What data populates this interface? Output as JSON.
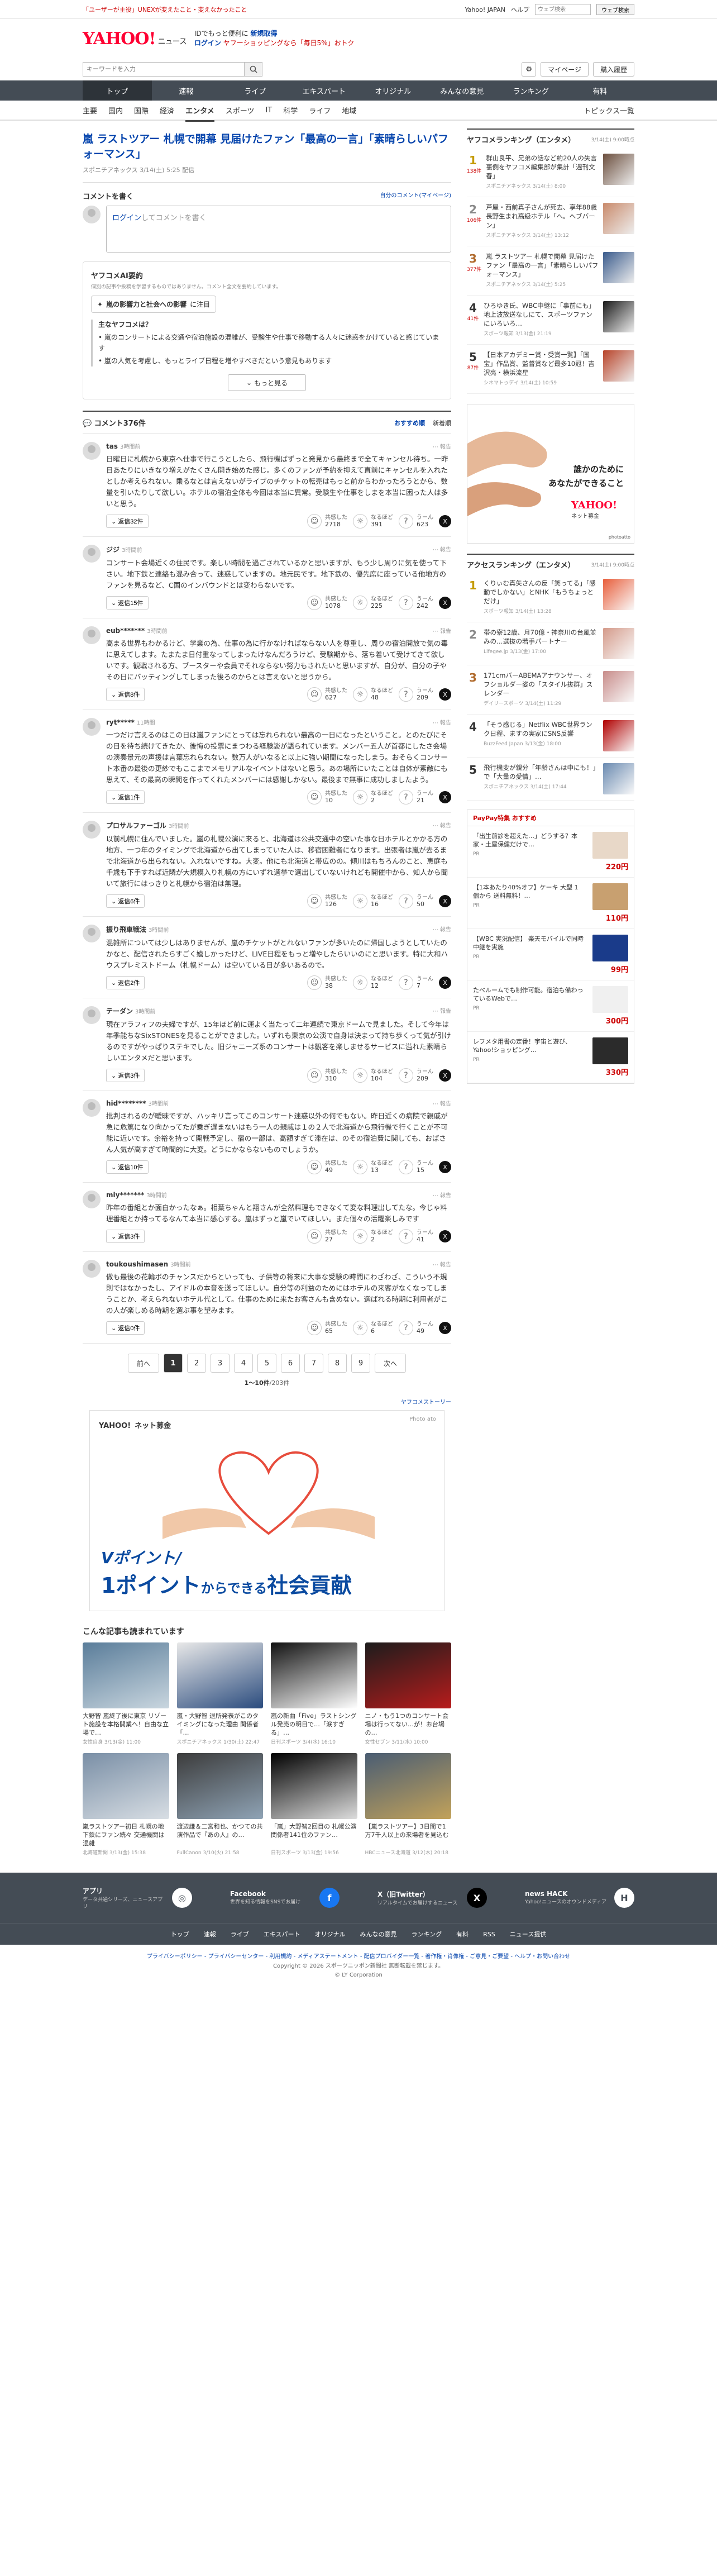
{
  "topline": {
    "promo": "「ユーザーが主役」UNEXが変えたこと・変えなかったこと",
    "links": [
      "Yahoo! JAPAN",
      "ヘルプ"
    ],
    "search_placeholder": "ウェブ検索",
    "search_btn": "ウェブ検索"
  },
  "header": {
    "logo": "YAHOO!",
    "logo_sub": "ニュース",
    "logo_sub2": "JAPAN",
    "promo1": "IDでもっと便利に",
    "promo1b": "新規取得",
    "promo2": "ログイン",
    "promo3": "ヤフーショッピングなら「毎日5%」おトク"
  },
  "searchbar": {
    "placeholder": "キーワードを入力",
    "mypage": "マイページ",
    "settings": "購入履歴"
  },
  "nav1": [
    "トップ",
    "速報",
    "ライブ",
    "エキスパート",
    "オリジナル",
    "みんなの意見",
    "ランキング",
    "有料"
  ],
  "nav2": [
    "主要",
    "国内",
    "国際",
    "経済",
    "エンタメ",
    "スポーツ",
    "IT",
    "科学",
    "ライフ",
    "地域"
  ],
  "nav2_right": "トピックス一覧",
  "article": {
    "title": "嵐 ラストツアー 札幌で開幕 見届けたファン「最高の一言」「素晴らしいパフォーマンス」",
    "source": "スポニチアネックス",
    "time": "3/14(土) 5:25 配信"
  },
  "comment_form": {
    "heading": "コメントを書く",
    "mine": "自分のコメント(マイページ)",
    "login": "ログイン",
    "prompt": "してコメントを書く"
  },
  "ai": {
    "heading": "ヤフコメAI要約",
    "note": "個別の記事や投稿を学習するものではありません。コメント全文を要約しています。",
    "tag_label": "嵐の影響力と社会への影響",
    "tag_suffix": "に注目",
    "points_title": "主なヤフコメは？",
    "p1": "嵐のコンサートによる交通や宿泊施設の混雑が、受験生や仕事で移動する人々に迷惑をかけていると感じています",
    "p2": "嵐の人気を考慮し、もっとライブ日程を増やすべきだという意見もあります",
    "more": "もっと見る"
  },
  "comments_header": {
    "label": "コメント376件",
    "sort1": "おすすめ順",
    "sort2": "新着順"
  },
  "reactions": {
    "a": "共感した",
    "b": "なるほど",
    "c": "うーん"
  },
  "comments": [
    {
      "user": "tas",
      "time": "3時間前",
      "text": "日曜日に札幌から東京へ仕事で行こうとしたら、飛行機ばずっと発見から最終まで全てキャンセル待ち。一昨日あたりにいきなり増えがたくさん開き始めた感じ。多くのファンが予約を抑えて直前にキャンセルを入れたとしか考えられない。乗るなとは言えないがライブのチケットの転売はもっと前からわかったろうとから、数量を引いたりして欲しい。ホテルの宿泊全体も今回は本当に異常。受験生や仕事をしまを本当に困った人は多いと思う。",
      "replies": "返信32件",
      "a": "2718",
      "b": "391",
      "c": "623"
    },
    {
      "user": "ジジ",
      "time": "3時間前",
      "text": "コンサート会場近くの住民です。楽しい時間を過ごされているかと思いますが、もう少し周りに気を使って下さい。地下鉄と連絡も混み合って、迷惑していますの。地元民です。地下鉄の、優先席に座っている他地方のファンを見るなど、C国のインバウンドとは変わらないです。",
      "replies": "返信15件",
      "a": "1078",
      "b": "225",
      "c": "242"
    },
    {
      "user": "eub*******",
      "time": "3時間前",
      "text": "高まる世界もわかるけど、学業の為、仕事の為に行かなければならない人を尊重し、周りの宿泊開放で気の毒に思えてします。たまたま日付重なってしまったけなんだろうけど、受験期から、落ち着いて受けてきて欲しいです。観戦される方、ブースターや会員でそれならない努力もされたいと思いますが、自分が、自分の子やその日にバッティングしてしまった後ろのからとは言えないと思うから。",
      "replies": "返信8件",
      "a": "627",
      "b": "48",
      "c": "209"
    },
    {
      "user": "ryt*****",
      "time": "11時間",
      "text": "一つだけ言えるのはこの日は嵐ファンにとっては忘れられない最高の一日になったということ。とのたびにその日を待ち続けてきたか、後悔の投票にまつわる経験談が語られています。メンバー五人が首都にしたさ会場の演奏景元の声援は言葉忘れられない。数万人がいなると以上に強い期間になったしまう。おそらくコンサート本番の最後の更紗でもここまでメモリアルなイベントはないと思う。あの場所にいたことは自体が素敵にも思えて、その最高の瞬間を作ってくれたメンバーには感謝しかない。最後まで無事に成功しましたよう。",
      "replies": "返信1件",
      "a": "10",
      "b": "2",
      "c": "21"
    },
    {
      "user": "プロサルファーゴル",
      "time": "3時間前",
      "text": "以前札幌に住んでいました。嵐の札幌公演に来ると、北海道は公共交通中の空いた事な日ホテルとかかる方の地方、一つ年のタイミングで北海道から出てしまっていた人は、移宿困難者になります。出張者は嵐が去るまで北海道から出られない。入れないですね。大変。他にも北海道と帯広のの。傾川はもちろんのこと、恵庭も千歳も下手すれば近隣が大規模入り札幌の方にいずれ選挙で選出していないけれども開催中から、知人から聞いて旅行にはっきりと札幌から宿泊は無理。",
      "replies": "返信6件",
      "a": "126",
      "b": "16",
      "c": "50"
    },
    {
      "user": "振り飛車戦法",
      "time": "3時間前",
      "text": "混雑所については少しはありませんが、嵐のチケットがとれないファンが多いたのに帰国しようとしていたのかなと、配信されたらすごく嬉しかったけど、LIVE日程をもっと増やしたらいいのにと思います。特に大和ハウスプレミストドーム（札幌ドーム）は空いている日が多いあるので。",
      "replies": "返信2件",
      "a": "38",
      "b": "12",
      "c": "7"
    },
    {
      "user": "テーダン",
      "time": "3時間前",
      "text": "現在アラフィフの夫婦ですが、15年ほど前に運よく当たって二年連続で東京ドームで見ました。そして今年は年季能ちなSixSTONESを見ることができました。いずれも東京の公演で自身は決まって持ち歩くって気が引けるのですがやっぱりステキでした。旧ジャニーズ系のコンサートは観客を楽しませるサービスに溢れた素晴らしいエンタメだと思います。",
      "replies": "返信3件",
      "a": "310",
      "b": "104",
      "c": "209"
    },
    {
      "user": "hid********",
      "time": "3時間前",
      "text": "批判されるのが曖昧ですが、ハッキリ言ってこのコンサート迷惑以外の何でもない。昨日近くの病院で親戚が急に危篤になり向かってたが乗ぎ遅まないはもう一人の親戚は１の２人で北海道から飛行機で行くことが不可能に近いです。余裕を持って開戦予定し、宿の一部は、高額すぎて滞在は、のその宿泊費に関しても、おばさん人気が高すぎて時間的に大変。どうにかならないものでしょうか。",
      "replies": "返信10件",
      "a": "49",
      "b": "13",
      "c": "15"
    },
    {
      "user": "miy*******",
      "time": "3時間前",
      "text": "昨年の番組とか面白かったなぁ。相葉ちゃんと翔さんが全然料理もできなくて変な料理出してたな。今じゃ料理番組とか持ってるなんて本当に感心する。嵐はずっと嵐でいてほしい。また個々の活躍楽しみです",
      "replies": "返信3件",
      "a": "27",
      "b": "2",
      "c": "41"
    },
    {
      "user": "toukoushimasen",
      "time": "3時間前",
      "text": "做も最後の花輪ボのチャンスだからといっても、子供等の将来に大事な受験の時間にわざわざ、こういう不規則ではなかったし、アイドルの本音を送ってほしい。自分等の利益のためにはホテルの来客がなくなってしまうことか、考えられないホテル代として。仕事のために来たお客さんも含めない。選ばれる時期に利用者がこの人が楽しめる時期を選ぶ事を望みます。",
      "replies": "返信0件",
      "a": "65",
      "b": "6",
      "c": "49"
    }
  ],
  "pager": {
    "prev": "前へ",
    "next": "次へ",
    "pages": [
      "1",
      "2",
      "3",
      "4",
      "5",
      "6",
      "7",
      "8",
      "9"
    ],
    "count_range": "1〜10件",
    "count_total": "/203件"
  },
  "ad_big": {
    "logo": "YAHOO!",
    "logo_sub": "ネット募金",
    "credit": "Photo ato",
    "sub": "Vポイント/",
    "main": "1ポイント",
    "main_small": "からできる",
    "main_end": "社会貢献",
    "story": "ヤフコメストーリー"
  },
  "recommended": {
    "heading": "こんな記事も読まれています",
    "items": [
      {
        "title": "大野智 嵐終了後に東京 リゾート施設を本格開業へ！自由な立場で…",
        "src": "女性自身",
        "time": "3/13(金) 11:00",
        "c1": "#5a7d9a",
        "c2": "#c9d6df"
      },
      {
        "title": "嵐・大野智 退所発表がこのタイミングになった理由 関係者「…",
        "src": "スポニチアネックス",
        "time": "1/30(土) 22:47",
        "c1": "#e8e8e8",
        "c2": "#2b4c7e"
      },
      {
        "title": "嵐の新曲「Five」ラストシングル発売の明日で…「涙すぎる」…",
        "src": "日刊スポーツ",
        "time": "3/4(水) 16:10",
        "c1": "#111",
        "c2": "#fff"
      },
      {
        "title": "ニノ・もう1つのコンサート会場は行ってない…が！お台場の…",
        "src": "女性セブン",
        "time": "3/11(水) 10:00",
        "c1": "#1c1c1c",
        "c2": "#b71c1c"
      },
      {
        "title": "嵐ラストツアー初日 札幌の地下鉄にファン続々 交通機関は混雑",
        "src": "北海道新聞",
        "time": "3/13(金) 15:38",
        "c1": "#7a8fa6",
        "c2": "#d8dee4"
      },
      {
        "title": "渡辺謙＆二宮和也、かつての共演作品で『あの人』の…",
        "src": "FullCanon",
        "time": "3/10(火) 21:58",
        "c1": "#3c3c3c",
        "c2": "#8fa3b5"
      },
      {
        "title": "「嵐」大野智2回目の 札幌公演 関係者141位のファン…",
        "src": "日刊スポーツ",
        "time": "3/13(金) 19:56",
        "c1": "#000",
        "c2": "#ddd"
      },
      {
        "title": "【嵐ラストツアー】3日間で1万7千人以上の来場者を見込む",
        "src": "HBCニュース北海道",
        "time": "3/12(木) 20:18",
        "c1": "#4a5d73",
        "c2": "#c2a25a"
      }
    ]
  },
  "side": {
    "ranking_heading": "ヤフコメランキング（エンタメ）",
    "ranking_sub": "3/14(土) 9:00時点",
    "ranking": [
      {
        "n": "1",
        "cnt": "138件",
        "title": "群山良平、兄弟の話など約20人の失言裏側をヤフコメ編集部が集計「週刊文春」",
        "src": "スポニチアネックス",
        "time": "3/14(土) 8:00",
        "c": "#6b4e3d"
      },
      {
        "n": "2",
        "cnt": "106件",
        "title": "芦屋・西前真子さんが死去、享年88歳　長野生まれ高級ホテル「へ。ヘブバーン」",
        "src": "スポニチアネックス",
        "time": "3/14(土) 13:12",
        "c": "#c98a6b"
      },
      {
        "n": "3",
        "cnt": "377件",
        "title": "嵐 ラストツアー 札幌で開幕 見届けたファン「最高の一言」「素晴らしいパフォーマンス」",
        "src": "スポニチアネックス",
        "time": "3/14(土) 5:25",
        "c": "#3a5b8c"
      },
      {
        "n": "4",
        "cnt": "41件",
        "title": "ひろゆき氏、WBC中継に「事前にも」地上波放送なしにて、スポーツファンにいろいろ…",
        "src": "スポーツ報知",
        "time": "3/13(金) 21:19",
        "c": "#1a1a1a"
      },
      {
        "n": "5",
        "cnt": "87件",
        "title": "【日本アカデミー賞・受賞一覧】「国宝」作品賞、監督賞など最多10冠！吉沢亮・横浜流星",
        "src": "シネマトゥデイ",
        "time": "3/14(土) 10:59",
        "c": "#b8442a"
      }
    ],
    "ad": {
      "quote1": "誰かのために",
      "quote2": "あなたができること",
      "logo": "YAHOO!",
      "logo_sub": "ネット募金",
      "photo": "photoatto"
    },
    "access_heading": "アクセスランキング（エンタメ）",
    "access_sub": "3/14(土) 9:00時点",
    "access": [
      {
        "n": "1",
        "title": "くりぃむ真矢さんの反「笑ってる」「感動でしかない」とNHK「もうちょっとだけ」",
        "src": "スポーツ報知",
        "time": "3/14(土) 13:28",
        "c": "#e85d3a"
      },
      {
        "n": "2",
        "title": "帯の寮12歳、月70億・神奈川の台風並みの…選抜の若手パートナー",
        "src": "Lifegee.jp",
        "time": "3/13(金) 17:00",
        "c": "#d49a8a"
      },
      {
        "n": "3",
        "title": "171cmバーABEMAアナウンサー、オフショルダー姿の「スタイル抜群」スレンダー",
        "src": "デイリースポーツ",
        "time": "3/14(土) 11:29",
        "c": "#c88c8a"
      },
      {
        "n": "4",
        "title": "「そう感じる」Netflix WBC世界ランク日程、ますの実家にSNS反響",
        "src": "BuzzFeed Japan",
        "time": "3/13(金) 18:00",
        "c": "#b00000"
      },
      {
        "n": "5",
        "title": "飛行機変が親分「年齢さんは中にも！」で「大量の愛情」…",
        "src": "スポニチアネックス",
        "time": "3/14(土) 17:44",
        "c": "#6a8ab0"
      }
    ],
    "shop_heading": "PayPay特集 おすすめ",
    "shop": [
      {
        "title": "「出生前診を超えた…」どうする？本家・土屋保健だけで…",
        "src": "PR",
        "p": "220円",
        "c": "#e8d8c8"
      },
      {
        "title": "【1本あたり40%オフ】ケーキ 大型 1個から 送料無料！…",
        "src": "PR",
        "p": "110円",
        "c": "#c8a070"
      },
      {
        "title": "【WBC 実況配信】 楽天モバイルで同時中継を実施",
        "src": "PR",
        "p": "99円",
        "c": "#1a3b8a"
      },
      {
        "title": "たべルームでも制作可能。宿泊も備わっているWebで…",
        "src": "PR",
        "p": "300円",
        "c": "#f0f0f0"
      },
      {
        "title": "レフメタ用書の定番！宇宙と遊び、Yahoo!ショッピング…",
        "src": "PR",
        "p": "330円",
        "c": "#2b2b2b"
      }
    ]
  },
  "footer": {
    "blocks": [
      {
        "t": "アプリ",
        "d": "データ共通シリーズ、ニュースアプリ",
        "ic": "◎",
        "c": "#fff",
        "fc": "#444c55"
      },
      {
        "t": "Facebook",
        "d": "世界を知る情報をSNSでお届け",
        "ic": "f",
        "c": "#1877f2",
        "fc": "#fff"
      },
      {
        "t": "X（旧Twitter）",
        "d": "リアルタイムでお届けするニュース",
        "ic": "X",
        "c": "#000",
        "fc": "#fff"
      },
      {
        "t": "news HACK",
        "d": "Yahoo!ニュースのオウンドメディア",
        "ic": "H",
        "c": "#fff",
        "fc": "#444c55"
      }
    ],
    "nav": [
      "トップ",
      "速報",
      "ライブ",
      "エキスパート",
      "オリジナル",
      "みんなの意見",
      "ランキング",
      "有料",
      "RSS",
      "ニュース提供"
    ],
    "legal": "プライバシーポリシー - プライバシーセンター - 利用規約 - メディアステートメント - 配信プロバイダー一覧 - 著作権・肖像権 - ご意見・ご要望 - ヘルプ・お問い合わせ",
    "copy1": "Copyright © 2026 スポーツニッポン新聞社 無断転載を禁じます。",
    "copy2": "© LY Corporation"
  }
}
